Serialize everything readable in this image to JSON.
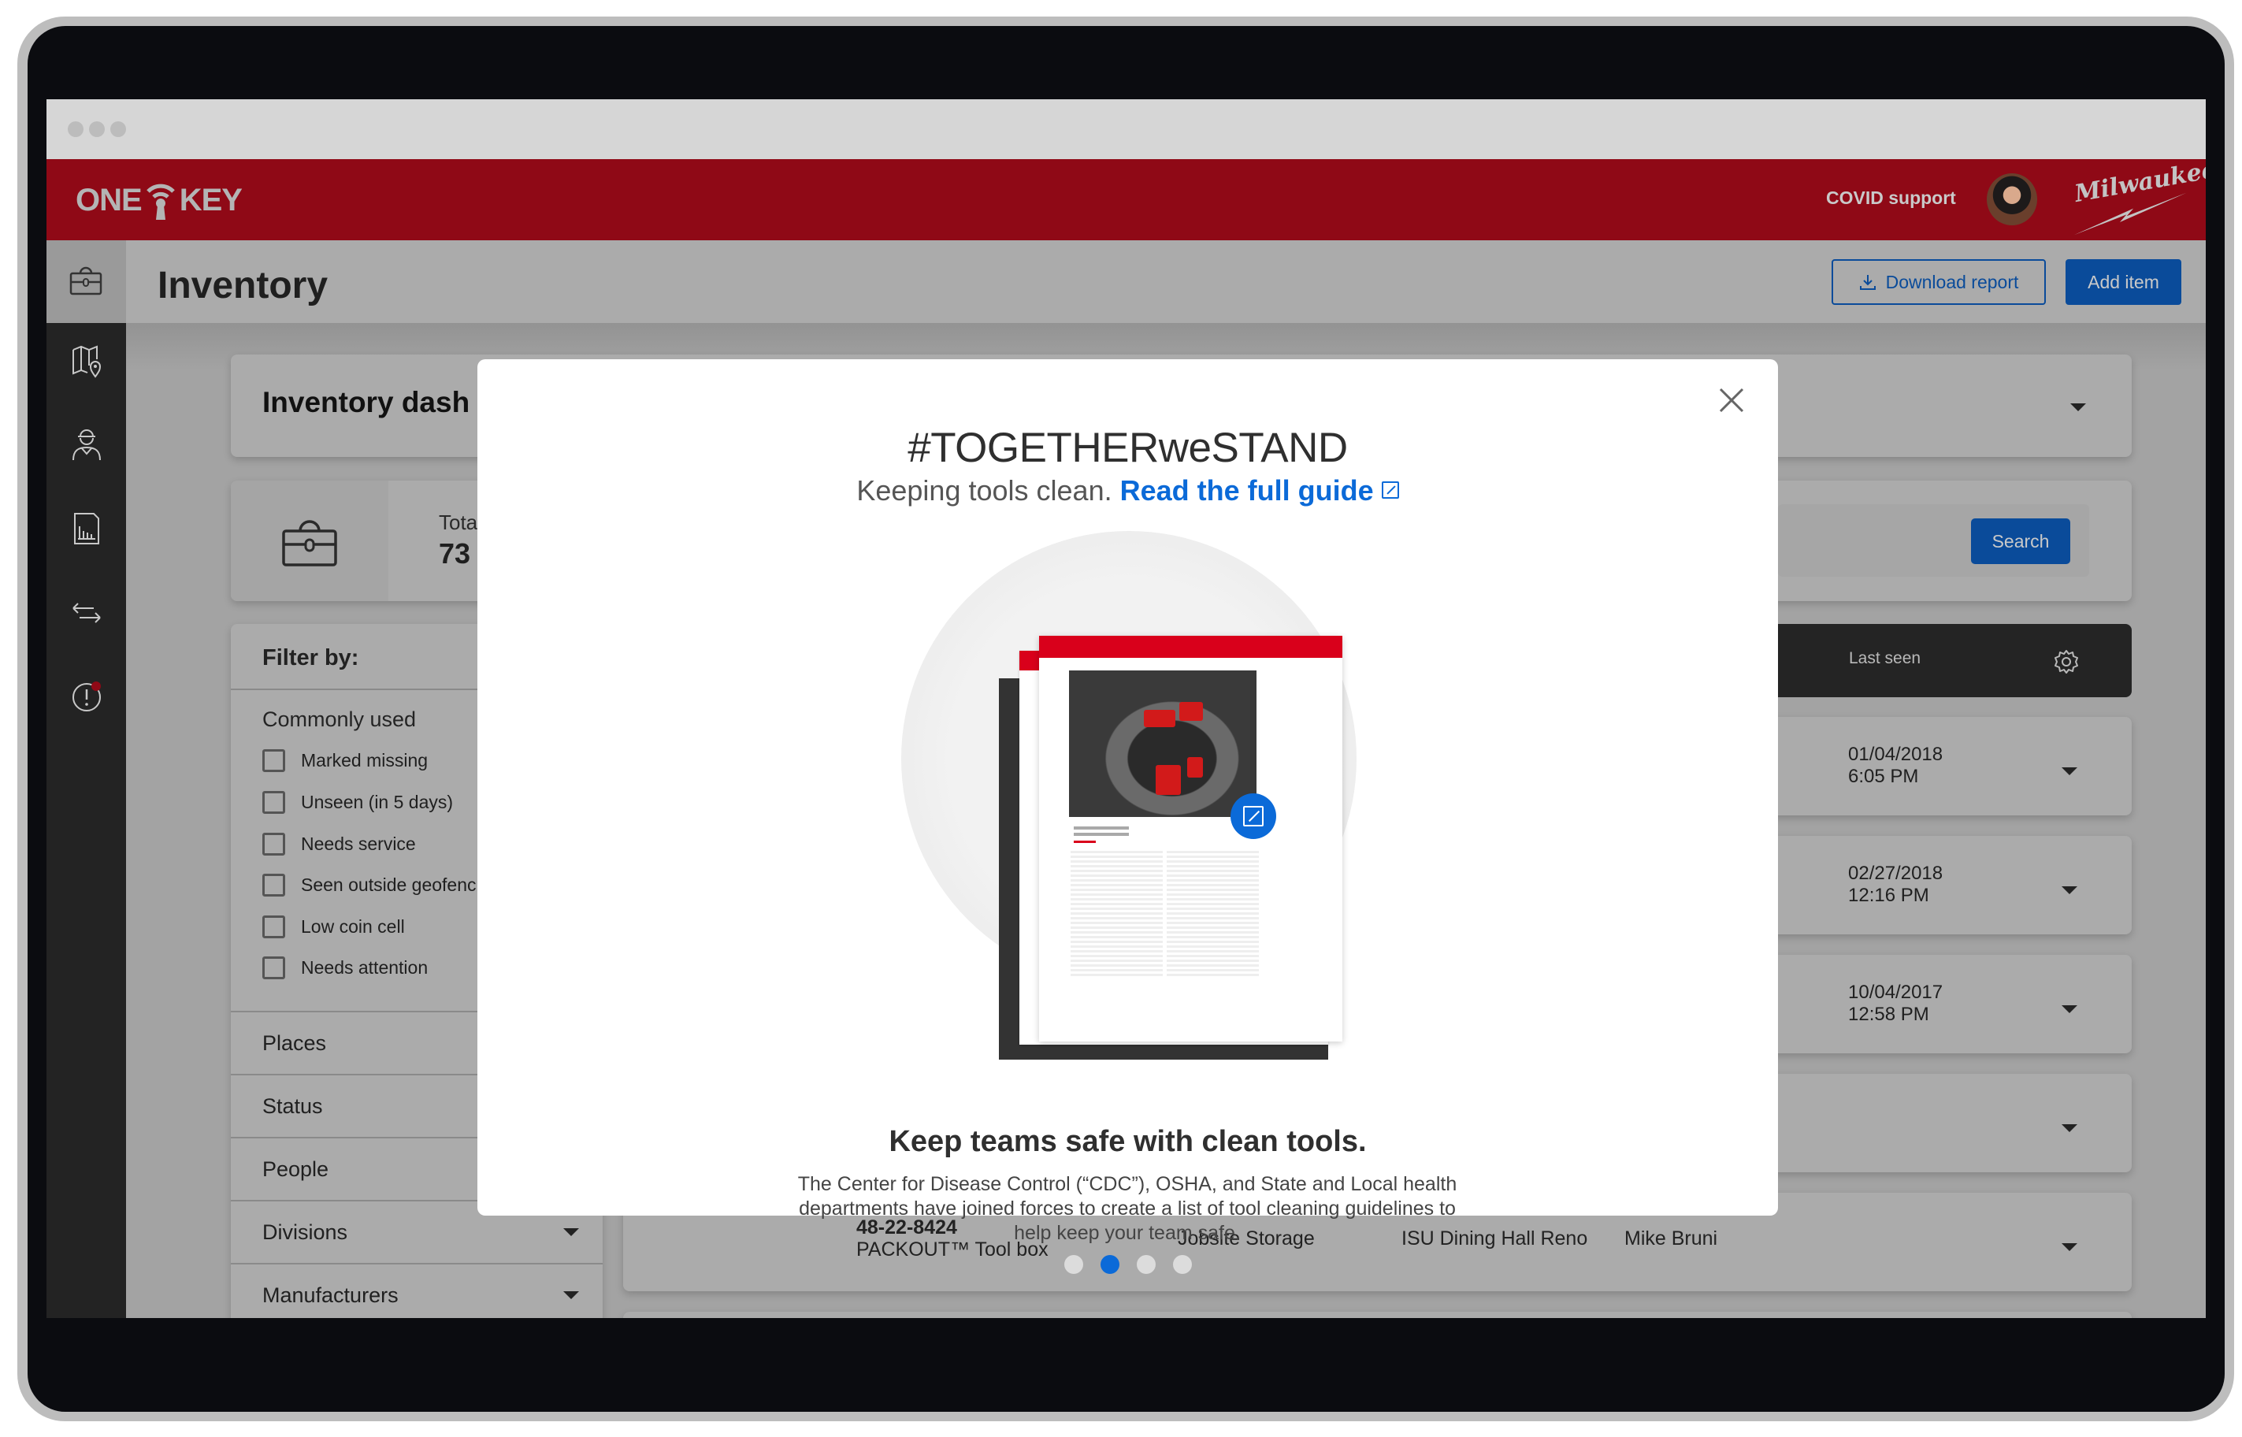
{
  "app": {
    "logo_text_left": "ONE",
    "logo_text_right": "KEY",
    "covid_link": "COVID support",
    "brand": "Milwaukee"
  },
  "page": {
    "title": "Inventory",
    "download_report": "Download report",
    "add_item": "Add item"
  },
  "sidebar": {
    "items": [
      {
        "name": "inventory",
        "icon": "toolbox-icon",
        "active": true
      },
      {
        "name": "map",
        "icon": "map-pin-icon",
        "active": false
      },
      {
        "name": "people",
        "icon": "worker-icon",
        "active": false
      },
      {
        "name": "reports",
        "icon": "report-chart-icon",
        "active": false
      },
      {
        "name": "transfers",
        "icon": "transfer-arrows-icon",
        "active": false
      },
      {
        "name": "alerts",
        "icon": "alert-icon",
        "active": false,
        "badge": true
      }
    ]
  },
  "dashboard": {
    "title": "Inventory dash"
  },
  "stats": {
    "label": "Tota",
    "value": "73",
    "search_button": "Search"
  },
  "filters": {
    "title": "Filter by:",
    "commonly_used": "Commonly used",
    "checkboxes": [
      {
        "label": "Marked missing",
        "checked": false
      },
      {
        "label": "Unseen (in 5 days)",
        "checked": false
      },
      {
        "label": "Needs service",
        "checked": false
      },
      {
        "label": "Seen outside geofenc",
        "checked": false
      },
      {
        "label": "Low coin cell",
        "checked": false
      },
      {
        "label": "Needs attention",
        "checked": false
      }
    ],
    "sections": [
      "Places",
      "Status",
      "People",
      "Divisions",
      "Manufacturers"
    ]
  },
  "table": {
    "header": {
      "last_seen": "Last seen"
    },
    "rows": [
      {
        "date": "01/04/2018",
        "time": "6:05 PM"
      },
      {
        "date": "02/27/2018",
        "time": "12:16 PM"
      },
      {
        "date": "10/04/2017",
        "time": "12:58 PM"
      },
      {
        "date": "",
        "time": ""
      },
      {
        "model": "48-22-8424",
        "name": "PACKOUT™ Tool box",
        "place": "Jobsite Storage",
        "project": "ISU Dining Hall Reno",
        "person": "Mike Bruni"
      }
    ]
  },
  "modal": {
    "title": "#TOGETHERweSTAND",
    "subtitle": "Keeping tools clean.",
    "link_text": "Read the full guide",
    "heading": "Keep teams safe with clean tools.",
    "body": "The Center for Disease Control (“CDC”), OSHA, and State and Local health departments have joined forces to create a list of tool cleaning guidelines to help keep your team safe.",
    "pagination": {
      "total": 4,
      "active_index": 1
    }
  },
  "colors": {
    "brand_red": "#8f0916",
    "accent_blue": "#0a4b9a",
    "link_blue": "#0b6ad8",
    "doc_red": "#d9001b"
  }
}
